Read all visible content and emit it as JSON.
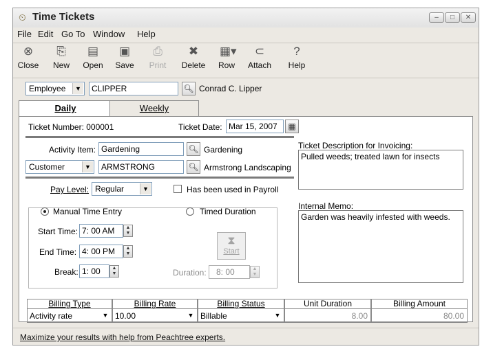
{
  "window": {
    "title": "Time Tickets"
  },
  "menu": [
    "File",
    "Edit",
    "Go To",
    "Window",
    "Help"
  ],
  "toolbar": {
    "close": "Close",
    "new": "New",
    "open": "Open",
    "save": "Save",
    "print": "Print",
    "delete": "Delete",
    "row": "Row",
    "attach": "Attach",
    "help": "Help"
  },
  "employee": {
    "type_value": "Employee",
    "id_value": "CLIPPER",
    "name": "Conrad C. Lipper"
  },
  "tabs": {
    "daily": "Daily",
    "weekly": "Weekly"
  },
  "ticket": {
    "number_label": "Ticket Number: 000001",
    "date_label": "Ticket Date:",
    "date_value": "Mar 15, 2007",
    "activity_label": "Activity Item:",
    "activity_value": "Gardening",
    "activity_name": "Gardening",
    "customer_type": "Customer",
    "customer_id": "ARMSTRONG",
    "customer_name": "Armstrong Landscaping",
    "pay_level_label": "Pay Level:",
    "pay_level_value": "Regular",
    "payroll_label": "Has been used in Payroll"
  },
  "time": {
    "manual_label": "Manual Time Entry",
    "timed_label": "Timed Duration",
    "start_label": "Start Time:",
    "start_value": "7: 00 AM",
    "end_label": "End Time:",
    "end_value": "4: 00 PM",
    "break_label": "Break:",
    "break_value": "1: 00",
    "start_button": "Start",
    "duration_label": "Duration:",
    "duration_value": "8: 00"
  },
  "description": {
    "label": "Ticket Description for Invoicing:",
    "value": "Pulled weeds; treated lawn for insects"
  },
  "memo": {
    "label": "Internal Memo:",
    "value": "Garden was heavily infested with weeds."
  },
  "billing": {
    "headers": [
      "Billing Type",
      "Billing Rate",
      "Billing Status",
      "Unit Duration",
      "Billing Amount"
    ],
    "type": "Activity rate",
    "rate": "10.00",
    "status": "Billable",
    "unit_duration": "8.00",
    "amount": "80.00"
  },
  "status": {
    "link": "Maximize your results with help from Peachtree experts."
  }
}
